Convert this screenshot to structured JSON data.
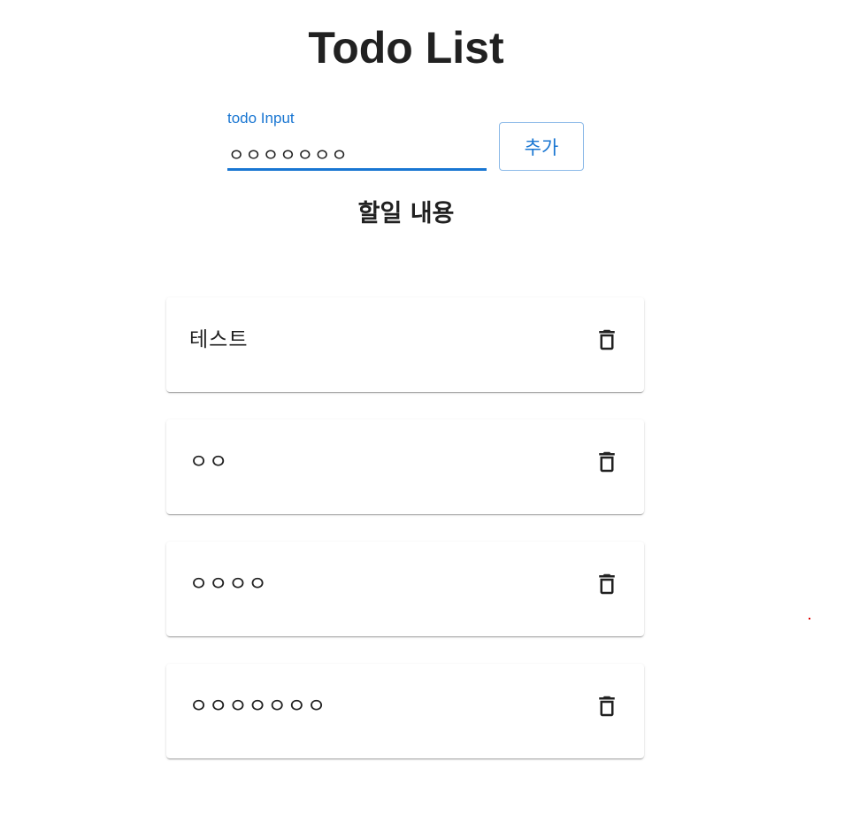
{
  "header": {
    "title": "Todo List"
  },
  "form": {
    "input_label": "todo Input",
    "input_value": "ㅇㅇㅇㅇㅇㅇㅇ",
    "add_label": "추가"
  },
  "list": {
    "heading": "할일 내용",
    "items": [
      {
        "text": "테스트"
      },
      {
        "text": "ㅇㅇ"
      },
      {
        "text": "ㅇㅇㅇㅇ"
      },
      {
        "text": "ㅇㅇㅇㅇㅇㅇㅇ"
      }
    ]
  },
  "icons": {
    "delete": "trash-icon"
  },
  "colors": {
    "accent": "#1976d2",
    "text": "#212121",
    "background": "#ffffff"
  }
}
